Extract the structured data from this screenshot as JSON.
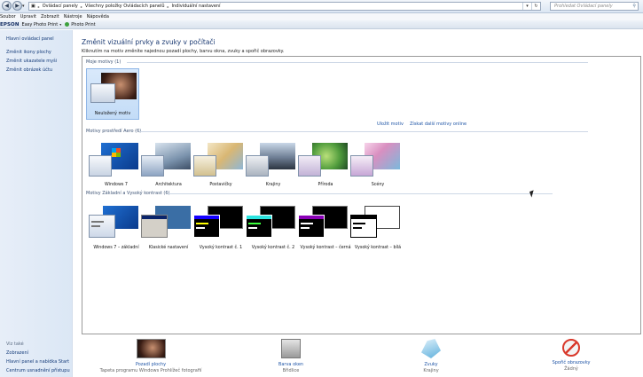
{
  "address": {
    "crumbs": [
      "Ovládací panely",
      "Všechny položky Ovládacích panelů",
      "Individuální nastavení"
    ],
    "search_placeholder": "Prohledat Ovládací panely"
  },
  "menu": [
    "Soubor",
    "Upravit",
    "Zobrazit",
    "Nástroje",
    "Nápověda"
  ],
  "toolbar": {
    "brand": "EPSON",
    "app": "Easy Photo Print",
    "photo": "Photo Print"
  },
  "leftnav": {
    "home": "Hlavní ovládací panel",
    "links": [
      "Změnit ikony plochy",
      "Změnit ukazatele myši",
      "Změnit obrázek účtu"
    ],
    "see_also_title": "Viz také",
    "see_also": [
      "Zobrazení",
      "Hlavní panel a nabídka Start",
      "Centrum usnadnění přístupu"
    ]
  },
  "main": {
    "title": "Změnit vizuální prvky a zvuky v počítači",
    "subtitle": "Kliknutím na motiv změníte najednou pozadí plochy, barvu okna, zvuky a spořič obrazovky."
  },
  "groups": {
    "mine": "Moje motivy (1)",
    "aero": "Motivy prostředí Aero (6)",
    "basic": "Motivy Základní a Vysoký kontrast (6)"
  },
  "links": {
    "save": "Uložit motiv",
    "online": "Získat další motivy online"
  },
  "mine_themes": [
    {
      "label": "Neuložený motiv"
    }
  ],
  "aero_themes": [
    {
      "label": "Windows 7"
    },
    {
      "label": "Architektura"
    },
    {
      "label": "Postavičky"
    },
    {
      "label": "Krajiny"
    },
    {
      "label": "Příroda"
    },
    {
      "label": "Scény"
    }
  ],
  "basic_themes": [
    {
      "label": "Windows 7 – základní"
    },
    {
      "label": "Klasické nastavení"
    },
    {
      "label": "Vysoký kontrast č. 1"
    },
    {
      "label": "Vysoký kontrast č. 2"
    },
    {
      "label": "Vysoký kontrast – černá"
    },
    {
      "label": "Vysoký kontrast – bílá"
    }
  ],
  "bottom": [
    {
      "title": "Pozadí plochy",
      "value": "Tapeta programu Windows Prohlížeč fotografií",
      "icon": "desktop-background-icon"
    },
    {
      "title": "Barva oken",
      "value": "Břidlice",
      "icon": "window-color-icon"
    },
    {
      "title": "Zvuky",
      "value": "Krajiny",
      "icon": "sounds-icon"
    },
    {
      "title": "Spořič obrazovky",
      "value": "Žádný",
      "icon": "screensaver-icon"
    }
  ],
  "colors": {
    "link": "#1f55a6",
    "title": "#1c3b73",
    "selection": "#c3dcf7"
  }
}
